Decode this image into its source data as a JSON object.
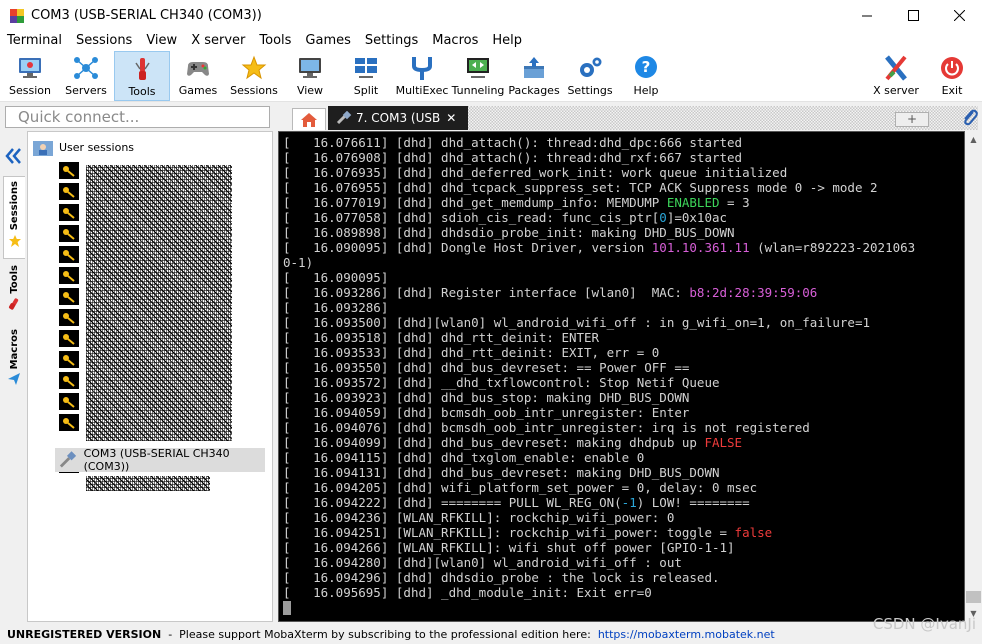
{
  "window": {
    "title": "COM3  (USB-SERIAL CH340 (COM3))"
  },
  "menu": [
    "Terminal",
    "Sessions",
    "View",
    "X server",
    "Tools",
    "Games",
    "Settings",
    "Macros",
    "Help"
  ],
  "toolbar": {
    "session": "Session",
    "servers": "Servers",
    "tools": "Tools",
    "games": "Games",
    "sessions": "Sessions",
    "view": "View",
    "split": "Split",
    "multiexec": "MultiExec",
    "tunneling": "Tunneling",
    "packages": "Packages",
    "settings": "Settings",
    "help": "Help",
    "xserver": "X server",
    "exit": "Exit"
  },
  "quick_connect": {
    "placeholder": "Quick connect..."
  },
  "tabs": {
    "active_label": "7. COM3  (USB",
    "close": "✕"
  },
  "sidebar": {
    "root": "User sessions",
    "tabs": [
      "Sessions",
      "Tools",
      "Macros"
    ],
    "selected_session": "COM3  (USB-SERIAL CH340 (COM3))"
  },
  "terminal": {
    "lines": [
      {
        "ts": "[   16.076611] ",
        "segs": [
          {
            "t": "[dhd] dhd_attach(): thread:dhd_dpc:666 started"
          }
        ]
      },
      {
        "ts": "[   16.076908] ",
        "segs": [
          {
            "t": "[dhd] dhd_attach(): thread:dhd_rxf:667 started"
          }
        ]
      },
      {
        "ts": "[   16.076935] ",
        "segs": [
          {
            "t": "[dhd] dhd_deferred_work_init: work queue initialized"
          }
        ]
      },
      {
        "ts": "[   16.076955] ",
        "segs": [
          {
            "t": "[dhd] dhd_tcpack_suppress_set: TCP ACK Suppress mode 0 -> mode 2"
          }
        ]
      },
      {
        "ts": "[   16.077019] ",
        "segs": [
          {
            "t": "[dhd] dhd_get_memdump_info: MEMDUMP "
          },
          {
            "t": "ENABLED",
            "c": "green"
          },
          {
            "t": " = 3"
          }
        ]
      },
      {
        "ts": "[   16.077058] ",
        "segs": [
          {
            "t": "[dhd] sdioh_cis_read: func_cis_ptr["
          },
          {
            "t": "0",
            "c": "cyan"
          },
          {
            "t": "]=0x10ac"
          }
        ]
      },
      {
        "ts": "[   16.089898] ",
        "segs": [
          {
            "t": "[dhd] dhdsdio_probe_init: making DHD_BUS_DOWN"
          }
        ]
      },
      {
        "ts": "[   16.090095] ",
        "segs": [
          {
            "t": "[dhd] Dongle Host Driver, version "
          },
          {
            "t": "101.10.361.11",
            "c": "mag"
          },
          {
            "t": " (wlan=r892223-2021063"
          }
        ]
      },
      {
        "ts": "",
        "segs": [
          {
            "t": "0-1)"
          }
        ]
      },
      {
        "ts": "[   16.090095]",
        "segs": []
      },
      {
        "ts": "[   16.093286] ",
        "segs": [
          {
            "t": "[dhd] Register interface [wlan0]  MAC: "
          },
          {
            "t": "b8:2d:28:39:59:06",
            "c": "mag"
          }
        ]
      },
      {
        "ts": "[   16.093286]",
        "segs": []
      },
      {
        "ts": "[   16.093500] ",
        "segs": [
          {
            "t": "[dhd][wlan0] wl_android_wifi_off : in g_wifi_on=1, on_failure=1"
          }
        ]
      },
      {
        "ts": "[   16.093518] ",
        "segs": [
          {
            "t": "[dhd] dhd_rtt_deinit: ENTER"
          }
        ]
      },
      {
        "ts": "[   16.093533] ",
        "segs": [
          {
            "t": "[dhd] dhd_rtt_deinit: EXIT, err = 0"
          }
        ]
      },
      {
        "ts": "[   16.093550] ",
        "segs": [
          {
            "t": "[dhd] dhd_bus_devreset: == Power OFF =="
          }
        ]
      },
      {
        "ts": "[   16.093572] ",
        "segs": [
          {
            "t": "[dhd] __dhd_txflowcontrol: Stop Netif Queue"
          }
        ]
      },
      {
        "ts": "[   16.093923] ",
        "segs": [
          {
            "t": "[dhd] dhd_bus_stop: making DHD_BUS_DOWN"
          }
        ]
      },
      {
        "ts": "[   16.094059] ",
        "segs": [
          {
            "t": "[dhd] bcmsdh_oob_intr_unregister: Enter"
          }
        ]
      },
      {
        "ts": "[   16.094076] ",
        "segs": [
          {
            "t": "[dhd] bcmsdh_oob_intr_unregister: irq is not registered"
          }
        ]
      },
      {
        "ts": "[   16.094099] ",
        "segs": [
          {
            "t": "[dhd] dhd_bus_devreset: making dhdpub up "
          },
          {
            "t": "FALSE",
            "c": "red"
          }
        ]
      },
      {
        "ts": "[   16.094115] ",
        "segs": [
          {
            "t": "[dhd] dhd_txglom_enable: enable 0"
          }
        ]
      },
      {
        "ts": "[   16.094131] ",
        "segs": [
          {
            "t": "[dhd] dhd_bus_devreset: making DHD_BUS_DOWN"
          }
        ]
      },
      {
        "ts": "[   16.094205] ",
        "segs": [
          {
            "t": "[dhd] wifi_platform_set_power = 0, delay: 0 msec"
          }
        ]
      },
      {
        "ts": "[   16.094222] ",
        "segs": [
          {
            "t": "[dhd] ======== PULL WL_REG_ON("
          },
          {
            "t": "-1",
            "c": "cyan"
          },
          {
            "t": ") LOW! ========"
          }
        ]
      },
      {
        "ts": "[   16.094236] ",
        "segs": [
          {
            "t": "[WLAN_RFKILL]: rockchip_wifi_power: 0"
          }
        ]
      },
      {
        "ts": "[   16.094251] ",
        "segs": [
          {
            "t": "[WLAN_RFKILL]: rockchip_wifi_power: toggle = "
          },
          {
            "t": "false",
            "c": "red"
          }
        ]
      },
      {
        "ts": "[   16.094266] ",
        "segs": [
          {
            "t": "[WLAN_RFKILL]: wifi shut off power [GPIO-1-1]"
          }
        ]
      },
      {
        "ts": "[   16.094280] ",
        "segs": [
          {
            "t": "[dhd][wlan0] wl_android_wifi_off : out"
          }
        ]
      },
      {
        "ts": "[   16.094296] ",
        "segs": [
          {
            "t": "[dhd] dhdsdio_probe : the lock is released."
          }
        ]
      },
      {
        "ts": "[   16.095695] ",
        "segs": [
          {
            "t": "[dhd] _dhd_module_init: Exit err=0"
          }
        ]
      }
    ]
  },
  "status": {
    "unregistered": "UNREGISTERED VERSION",
    "message": "  -  Please support MobaXterm by subscribing to the professional edition here:  ",
    "link": "https://mobaxterm.mobatek.net",
    "watermark": "CSDN @IvanJi"
  },
  "colors": {
    "green": "#3dd65a",
    "cyan": "#2aa6d8",
    "magenta": "#d75fd7",
    "red": "#ee3b3b",
    "terminal_bg": "#000000"
  }
}
